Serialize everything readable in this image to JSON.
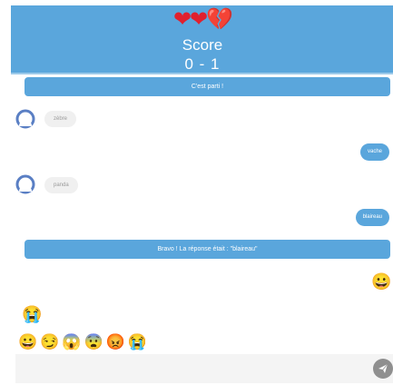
{
  "header": {
    "hearts": {
      "full": "❤❤",
      "broken": "💔"
    },
    "title": "Score",
    "score": "0 - 1"
  },
  "banners": {
    "start": "C'est parti !",
    "result": "Bravo ! La réponse était : \"blaireau\""
  },
  "messages": [
    {
      "side": "left",
      "text": "zèbre"
    },
    {
      "side": "right",
      "text": "vache"
    },
    {
      "side": "left",
      "text": "panda"
    },
    {
      "side": "right",
      "text": "blaireau"
    }
  ],
  "emojis": {
    "sent": "😀",
    "received": "😭"
  },
  "reactions": [
    "😀",
    "😏",
    "😱",
    "😨",
    "😡",
    "😭"
  ],
  "composer": {
    "placeholder": ""
  },
  "colors": {
    "accent": "#5aa6dc",
    "bubble_grey": "#f0f0f0",
    "send_button": "#8f8f8f"
  },
  "icons": {
    "avatar": "user-avatar-icon",
    "send": "paper-plane-icon"
  }
}
